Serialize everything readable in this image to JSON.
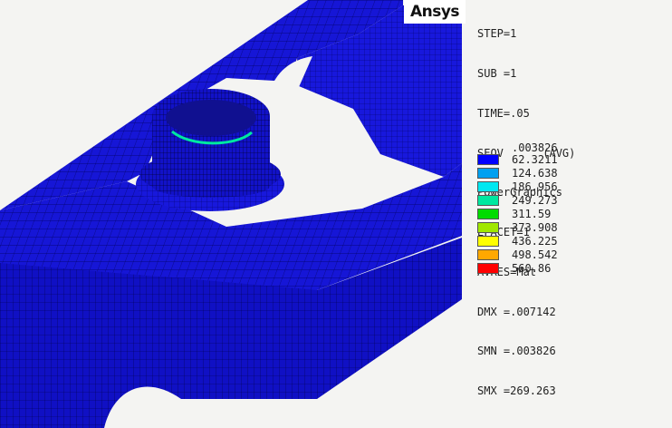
{
  "app": {
    "logo_text": "Ansys"
  },
  "result_info": [
    "STEP=1",
    "SUB =1",
    "TIME=.05",
    "SEQV      (AVG)",
    "PowerGraphics",
    "EFACET=1",
    "AVRES=Mat",
    "DMX =.007142",
    "SMN =.003826",
    "SMX =269.263"
  ],
  "legend": {
    "min_label": ".003826",
    "bands": [
      {
        "label": "62.3211",
        "color": "#0000ff"
      },
      {
        "label": "124.638",
        "color": "#00a0f0"
      },
      {
        "label": "186.956",
        "color": "#00e8f0"
      },
      {
        "label": "249.273",
        "color": "#00e8a0"
      },
      {
        "label": "311.59",
        "color": "#00dc00"
      },
      {
        "label": "373.908",
        "color": "#a0e800"
      },
      {
        "label": "436.225",
        "color": "#ffff00"
      },
      {
        "label": "498.542",
        "color": "#ffa800"
      },
      {
        "label": "560.86",
        "color": "#ff0000"
      }
    ]
  },
  "colors": {
    "mesh_fill": "#1414d2",
    "mesh_lines": "#000050",
    "background": "#f4f4f2"
  }
}
